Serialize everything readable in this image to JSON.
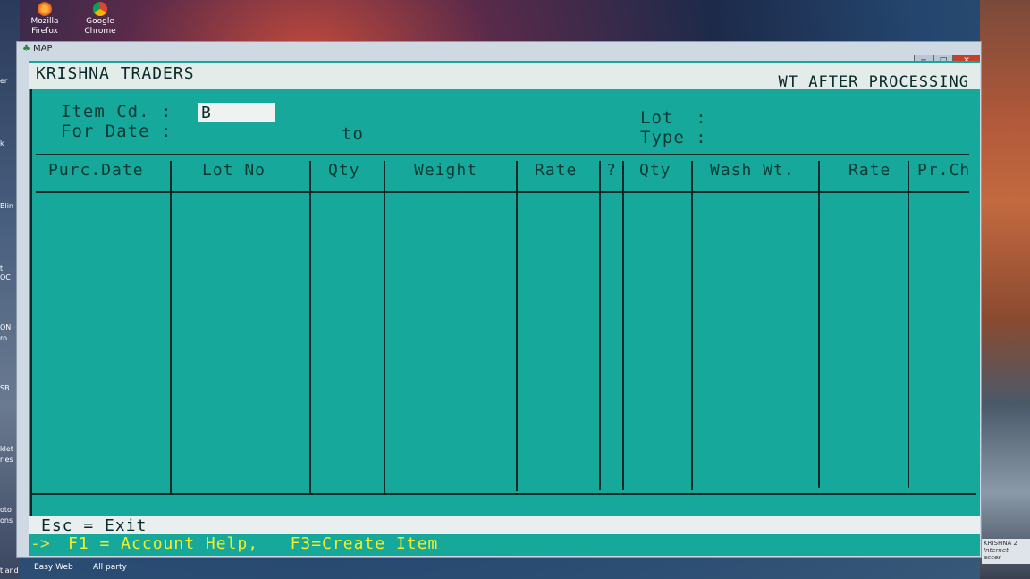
{
  "desktop": {
    "icons": [
      {
        "label1": "Mozilla",
        "label2": "Firefox"
      },
      {
        "label1": "Google",
        "label2": "Chrome"
      }
    ],
    "left_labels": [
      "er",
      "k",
      "Blin",
      "t",
      "OC",
      "ON",
      "ro",
      "SB",
      "klet",
      "ries",
      "oto",
      "ons",
      "t and"
    ],
    "bottom_icons": [
      "Easy Web",
      "All party"
    ],
    "notification": {
      "line1": "KRISHNA 2",
      "line2": "Internet acces"
    }
  },
  "window": {
    "title": "MAP",
    "min_label": "─",
    "max_label": "□",
    "close_label": "✕"
  },
  "console": {
    "company": "KRISHNA TRADERS",
    "screen_title": "WT AFTER PROCESSING",
    "item_cd_label": "Item Cd. :",
    "item_cd_value": "B",
    "for_date_label": "For Date :",
    "to_label": "to",
    "lot_label": "Lot  :",
    "type_label": "Type :",
    "columns": [
      "Purc.Date",
      "Lot No",
      "Qty",
      "Weight",
      "Rate",
      "?",
      "Qty",
      "Wash Wt.",
      "Rate",
      "Pr.Ch"
    ],
    "status_esc": "Esc = Exit",
    "help_arrow": "->",
    "help_text": "F1 = Account Help,   F3=Create Item"
  }
}
